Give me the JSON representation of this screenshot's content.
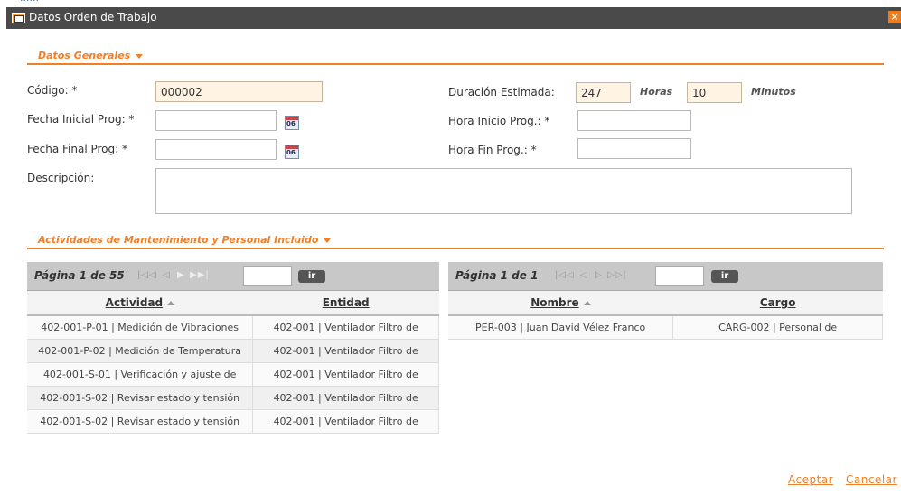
{
  "dialog": {
    "title": "Datos Orden de Trabajo",
    "close_glyph": "×"
  },
  "general": {
    "section_label": "Datos Generales",
    "codigo_label": "Código: *",
    "codigo_value": "000002",
    "fecha_inicial_label": "Fecha Inicial Prog: *",
    "fecha_inicial_value": "",
    "fecha_final_label": "Fecha Final Prog: *",
    "fecha_final_value": "",
    "descripcion_label": "Descripción:",
    "descripcion_value": "",
    "duracion_label": "Duración Estimada:",
    "duracion_horas_value": "247",
    "horas_label": "Horas",
    "duracion_minutos_value": "10",
    "minutos_label": "Minutos",
    "hora_inicio_label": "Hora Inicio Prog.: *",
    "hora_inicio_value": "",
    "hora_fin_label": "Hora Fin Prog.: *",
    "hora_fin_value": "",
    "calendar_text": "06"
  },
  "actividades": {
    "section_label": "Actividades de Mantenimiento y Personal Incluido",
    "left_grid": {
      "page_label": "Página 1 de 55",
      "go_label": "ir",
      "headers": [
        "Actividad",
        "Entidad"
      ],
      "rows": [
        [
          "402-001-P-01 | Medición de Vibraciones",
          "402-001 | Ventilador Filtro de"
        ],
        [
          "402-001-P-02 | Medición de Temperatura",
          "402-001 | Ventilador Filtro de"
        ],
        [
          "402-001-S-01 | Verificación y ajuste de",
          "402-001 | Ventilador Filtro de"
        ],
        [
          "402-001-S-02 | Revisar estado y tensión",
          "402-001 | Ventilador Filtro de"
        ],
        [
          "402-001-S-02 | Revisar estado y tensión",
          "402-001 | Ventilador Filtro de"
        ]
      ]
    },
    "right_grid": {
      "page_label": "Página 1 de 1",
      "go_label": "ir",
      "headers": [
        "Nombre",
        "Cargo"
      ],
      "rows": [
        [
          "PER-003 | Juan David Vélez Franco",
          "CARG-002 | Personal de"
        ]
      ]
    }
  },
  "footer": {
    "accept_label": "Aceptar",
    "cancel_label": "Cancelar"
  }
}
